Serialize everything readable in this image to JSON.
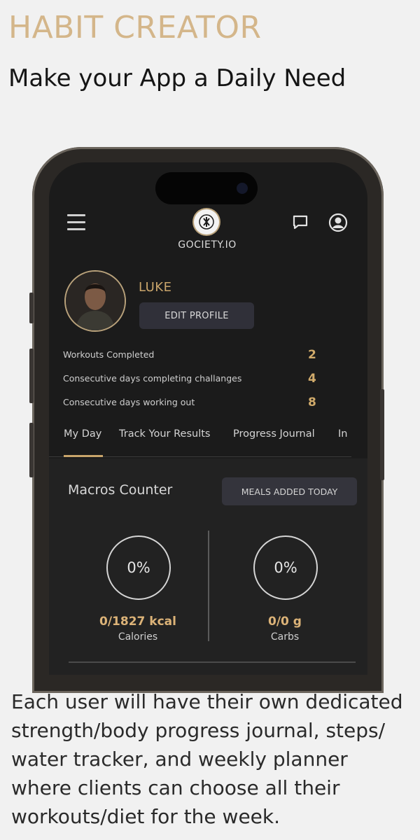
{
  "header": {
    "title": "HABIT CREATOR",
    "subtitle": "Make your App a Daily Need"
  },
  "app": {
    "brand": "GOCIETY.IO",
    "menu_icon": "hamburger-icon",
    "chat_icon": "chat-icon",
    "account_icon": "user-circle-icon",
    "profile": {
      "name": "LUKE",
      "edit_label": "EDIT PROFILE"
    },
    "stats": [
      {
        "label": "Workouts Completed",
        "value": "2"
      },
      {
        "label": "Consecutive days completing challanges",
        "value": "4"
      },
      {
        "label": "Consecutive days working out",
        "value": "8"
      }
    ],
    "tabs": [
      {
        "label": "My Day"
      },
      {
        "label": "Track Your Results"
      },
      {
        "label": "Progress Journal"
      },
      {
        "label": "In"
      }
    ],
    "active_tab": "My Day",
    "macros": {
      "title": "Macros Counter",
      "meals_button": "MEALS ADDED TODAY",
      "items": [
        {
          "percent": "0%",
          "value": "0/1827 kcal",
          "name": "Calories"
        },
        {
          "percent": "0%",
          "value": "0/0 g",
          "name": "Carbs"
        }
      ]
    }
  },
  "footer": {
    "description": "Each user will have their own dedicated strength/body progress journal, steps/ water tracker, and weekly planner where clients can choose all their workouts/diet for the week."
  },
  "colors": {
    "accent_gold": "#d4b68a",
    "screen_bg": "#1b1b1b",
    "page_bg": "#f1f1f1"
  }
}
